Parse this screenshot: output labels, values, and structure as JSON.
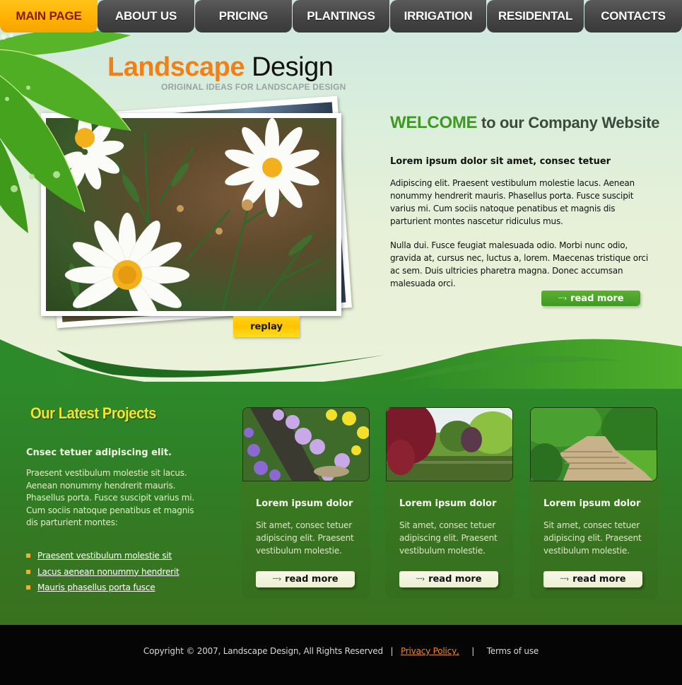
{
  "nav": {
    "items": [
      {
        "label": "MAIN PAGE",
        "active": true
      },
      {
        "label": "ABOUT US",
        "active": false
      },
      {
        "label": "PRICING",
        "active": false
      },
      {
        "label": "PLANTINGS",
        "active": false
      },
      {
        "label": "IRRIGATION",
        "active": false
      },
      {
        "label": "RESIDENTAL",
        "active": false
      },
      {
        "label": "CONTACTS",
        "active": false
      }
    ]
  },
  "logo": {
    "word1": "Landscape",
    "word2": "Design",
    "tagline": "ORIGINAL IDEAS FOR LANDSCAPE DESIGN"
  },
  "slideshow": {
    "replay_label": "replay"
  },
  "welcome": {
    "title_highlight": "WELCOME",
    "title_rest": "to our Company Website",
    "subtitle": "Lorem ipsum dolor sit amet, consec tetuer",
    "paragraph1": "Adipiscing elit. Praesent vestibulum molestie lacus. Aenean nonummy hendrerit mauris. Phasellus porta. Fusce suscipit varius mi. Cum sociis natoque penatibus et magnis dis parturient montes nascetur ridiculus mus.",
    "paragraph2": "Nulla dui. Fusce feugiat malesuada odio. Morbi nunc odio, gravida at, cursus nec, luctus a, lorem. Maecenas tristique orci ac sem. Duis ultricies pharetra magna. Donec accumsan malesuada orci.",
    "read_more_label": "read more",
    "arrow": "····›"
  },
  "projects": {
    "title": "Our Latest Projects",
    "subtitle": "Cnsec tetuer adipiscing elit.",
    "paragraph": "Praesent vestibulum molestie sit lacus. Aenean nonummy hendrerit mauris. Phasellus porta. Fusce suscipit varius mi. Cum sociis natoque penatibus et magnis dis parturient montes:",
    "links": [
      "Praesent vestibulum molestie sit",
      "Lacus aenean nonummy hendrerit",
      "Mauris phasellus porta fusce"
    ],
    "cards": [
      {
        "title": "Lorem ipsum dolor",
        "text": "Sit amet, consec tetuer adipiscing elit. Praesent vestibulum molestie.",
        "button": "read more",
        "image": "flower-pots-photo"
      },
      {
        "title": "Lorem ipsum dolor",
        "text": "Sit amet, consec tetuer adipiscing elit. Praesent vestibulum molestie.",
        "button": "read more",
        "image": "park-pond-photo"
      },
      {
        "title": "Lorem ipsum dolor",
        "text": "Sit amet, consec tetuer adipiscing elit. Praesent vestibulum molestie.",
        "button": "read more",
        "image": "garden-steps-photo"
      }
    ]
  },
  "footer": {
    "copyright": "Copyright © 2007, Landscape Design, All Rights Reserved",
    "separator": "|",
    "privacy_label": "Privacy Policy,",
    "terms_label": "Terms of use"
  },
  "colors": {
    "nav_active": "#ffb000",
    "nav_active_text": "#8a1a06",
    "nav_inactive": "#434343",
    "brand_orange": "#f47f14",
    "welcome_green": "#3f9a23",
    "projects_title_yellow": "#f6e22a",
    "privacy_link": "#e08a3a"
  }
}
